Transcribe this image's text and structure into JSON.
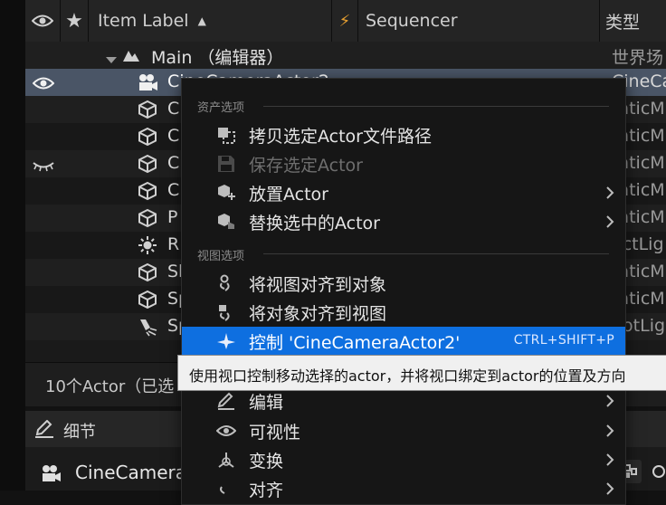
{
  "outliner": {
    "header": {
      "label_col": "Item Label",
      "sort_glyph": "▲",
      "sequencer_col": "Sequencer",
      "type_col": "类型"
    },
    "rows": [
      {
        "label": "Main （编辑器）",
        "type": "世界场",
        "icon": "level-icon"
      },
      {
        "label": "CineCameraActor2",
        "type": "CineCa",
        "icon": "camera-icon"
      },
      {
        "label": "C",
        "type": "taticM",
        "icon": "cube-icon"
      },
      {
        "label": "C",
        "type": "taticM",
        "icon": "cube-icon"
      },
      {
        "label": "C",
        "type": "taticM",
        "icon": "cube-icon"
      },
      {
        "label": "C",
        "type": "taticM",
        "icon": "cube-icon"
      },
      {
        "label": "P",
        "type": "taticM",
        "icon": "cube-icon"
      },
      {
        "label": "R",
        "type": "ectLig",
        "icon": "light-icon"
      },
      {
        "label": "Sl",
        "type": "taticM",
        "icon": "cube-icon"
      },
      {
        "label": "Sp",
        "type": "taticM",
        "icon": "cube-icon"
      },
      {
        "label": "Sp",
        "type": "potLig",
        "icon": "spotlight-icon"
      }
    ],
    "status": "10个Actor（已选"
  },
  "details": {
    "tab_label": "细节",
    "actor_name": "CineCamera"
  },
  "context_menu": {
    "section_asset": "资产选项",
    "section_view": "视图选项",
    "items_asset": [
      {
        "label": "拷贝选定Actor文件路径",
        "icon": "copy-path-icon",
        "disabled": false,
        "submenu": false
      },
      {
        "label": "保存选定Actor",
        "icon": "save-icon",
        "disabled": true,
        "submenu": false
      },
      {
        "label": "放置Actor",
        "icon": "place-actor-icon",
        "disabled": false,
        "submenu": true
      },
      {
        "label": "替换选中的Actor",
        "icon": "replace-actor-icon",
        "disabled": false,
        "submenu": true
      }
    ],
    "items_view": [
      {
        "label": "将视图对齐到对象",
        "icon": "snap-view-icon",
        "disabled": false,
        "submenu": false
      },
      {
        "label": "将对象对齐到视图",
        "icon": "snap-object-icon",
        "disabled": false,
        "submenu": false
      },
      {
        "label": "控制 'CineCameraActor2'",
        "icon": "pilot-icon",
        "disabled": false,
        "submenu": false,
        "shortcut": "CTRL+SHIFT+P",
        "highlighted": true
      },
      {
        "label": "编辑",
        "icon": "edit-icon",
        "disabled": false,
        "submenu": true
      },
      {
        "label": "可视性",
        "icon": "visibility-icon",
        "disabled": false,
        "submenu": true
      },
      {
        "label": "变换",
        "icon": "transform-icon",
        "disabled": false,
        "submenu": true
      },
      {
        "label": "对齐",
        "icon": "align-icon",
        "disabled": false,
        "submenu": true
      }
    ]
  },
  "tooltip": "使用视口控制移动选择的actor，并将视口绑定到actor的位置及方向"
}
